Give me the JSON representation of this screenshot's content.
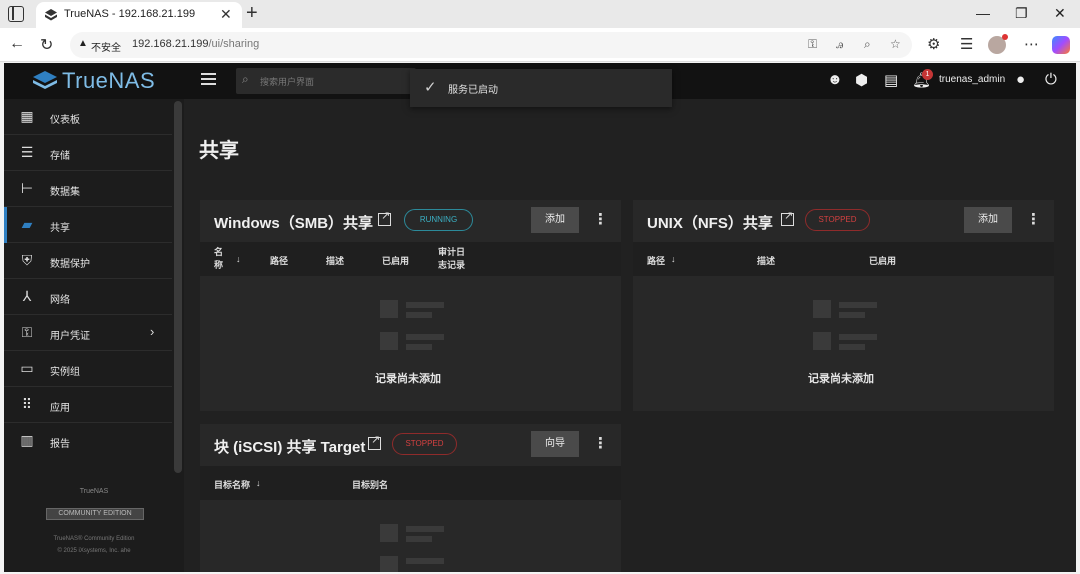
{
  "browser": {
    "tab_title": "TrueNAS - 192.168.21.199",
    "new_tab": "+",
    "insecure_label": "不安全",
    "url_host": "192.168.21.199",
    "url_path": "/ui/sharing"
  },
  "app": {
    "logo_text": "TrueNAS",
    "search_placeholder": "搜索用户界面",
    "toast": "服务已启动",
    "notification_count": "1",
    "user": "truenas_admin"
  },
  "sidebar": {
    "items": [
      {
        "label": "仪表板",
        "icon": "dashboard-icon"
      },
      {
        "label": "存储",
        "icon": "storage-icon"
      },
      {
        "label": "数据集",
        "icon": "datasets-icon"
      },
      {
        "label": "共享",
        "icon": "shares-icon"
      },
      {
        "label": "数据保护",
        "icon": "shield-icon"
      },
      {
        "label": "网络",
        "icon": "network-icon"
      },
      {
        "label": "用户凭证",
        "icon": "key-icon"
      },
      {
        "label": "实例组",
        "icon": "laptop-icon"
      },
      {
        "label": "应用",
        "icon": "apps-icon"
      },
      {
        "label": "报告",
        "icon": "reports-icon"
      }
    ],
    "footer_brand": "TrueNAS",
    "edition": "COMMUNITY EDITION",
    "copyright_1": "TrueNAS® Community Edition",
    "copyright_2": "© 2025 iXsystems, Inc. ahe"
  },
  "main": {
    "page_title": "共享",
    "smb": {
      "title": "Windows（SMB）共享",
      "status": "RUNNING",
      "add_button": "添加",
      "columns": [
        "名称",
        "路径",
        "描述",
        "已启用",
        "审计日志记录"
      ],
      "name_col_line1": "名",
      "name_col_line2": "称",
      "audit_col_line1": "审计日",
      "audit_col_line2": "志记录",
      "empty_text": "记录尚未添加"
    },
    "nfs": {
      "title": "UNIX（NFS）共享",
      "status": "STOPPED",
      "add_button": "添加",
      "columns": [
        "路径",
        "描述",
        "已启用"
      ],
      "empty_text": "记录尚未添加"
    },
    "iscsi": {
      "title": "块 (iSCSI) 共享 Target",
      "status": "STOPPED",
      "wizard_button": "向导",
      "columns": [
        "目标名称",
        "目标别名"
      ]
    },
    "sort_arrow": "↓"
  }
}
